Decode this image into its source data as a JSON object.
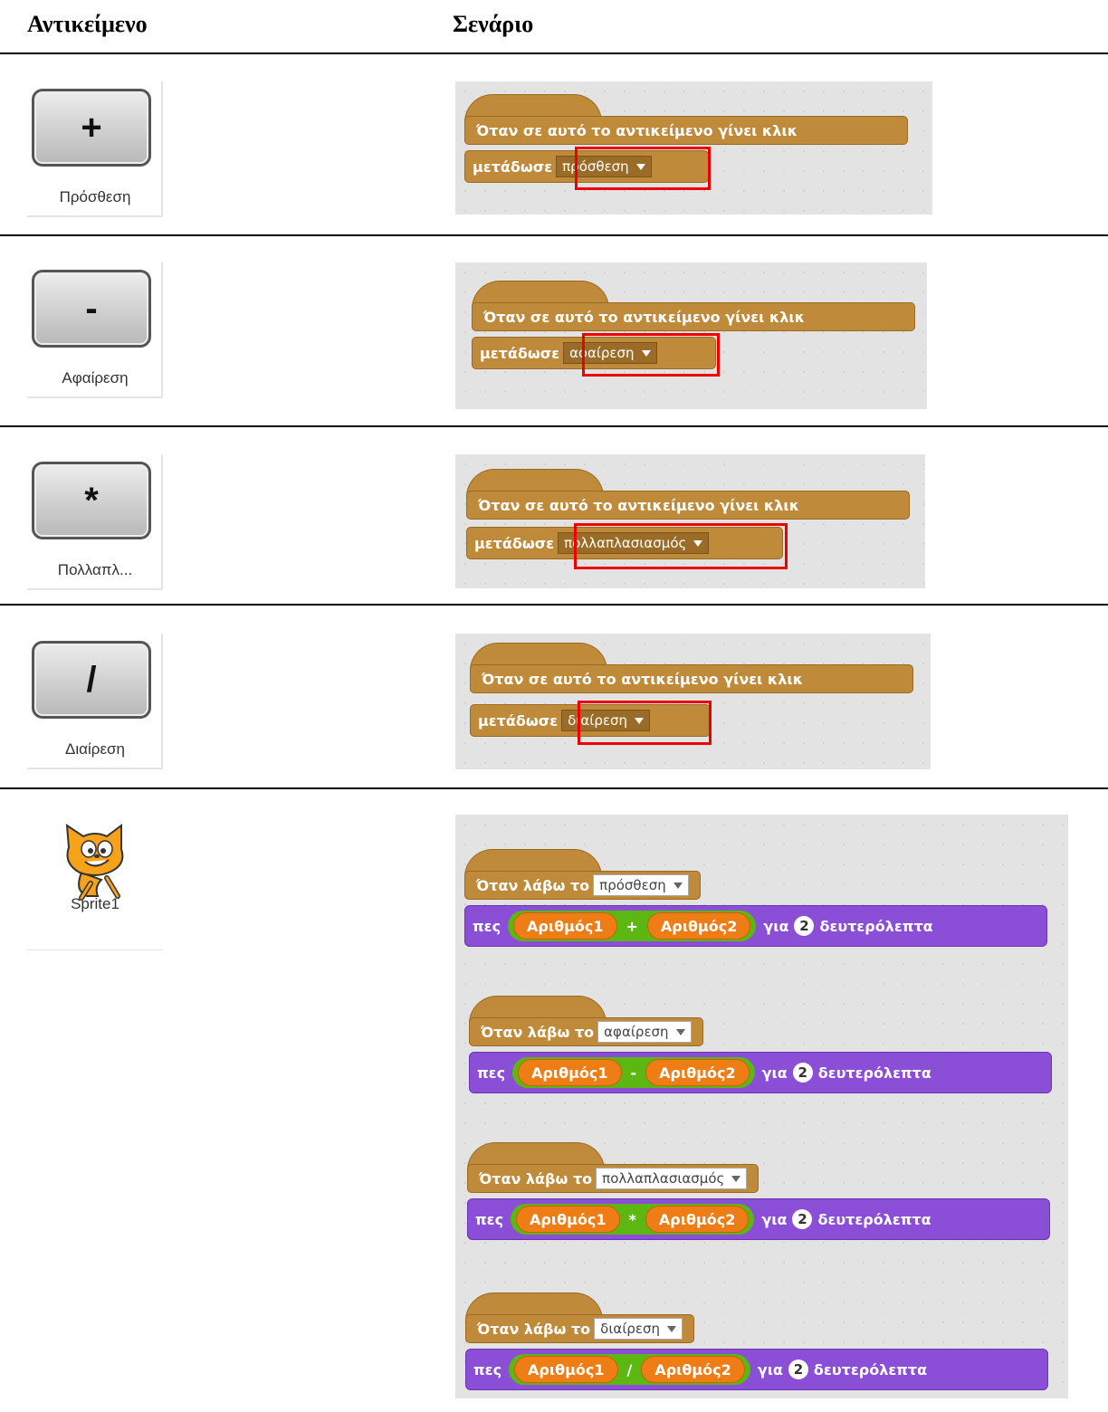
{
  "headers": {
    "object": "Αντικείμενο",
    "script": "Σενάριο"
  },
  "buttons": [
    {
      "symbol": "+",
      "name": "Πρόσθεση"
    },
    {
      "symbol": "-",
      "name": "Αφαίρεση"
    },
    {
      "symbol": "*",
      "name": "Πολλαπλ..."
    },
    {
      "symbol": "/",
      "name": "Διαίρεση"
    }
  ],
  "button_scripts": [
    {
      "hat": "Όταν σε αυτό το αντικείμενο γίνει κλικ",
      "cmd": "μετάδωσε",
      "message": "πρόσθεση"
    },
    {
      "hat": "Όταν σε αυτό το αντικείμενο γίνει κλικ",
      "cmd": "μετάδωσε",
      "message": "αφαίρεση"
    },
    {
      "hat": "Όταν σε αυτό το αντικείμενο γίνει κλικ",
      "cmd": "μετάδωσε",
      "message": "πολλαπλασιασμός"
    },
    {
      "hat": "Όταν σε αυτό το αντικείμενο γίνει κλικ",
      "cmd": "μετάδωσε",
      "message": "διαίρεση"
    }
  ],
  "sprite": {
    "name": "Sprite1"
  },
  "sprite_scripts": [
    {
      "hat": "Όταν λάβω το",
      "message": "πρόσθεση",
      "say": "πες",
      "var1": "Αριθμός1",
      "operator": "+",
      "var2": "Αριθμός2",
      "for": "για",
      "secs": "2",
      "unit": "δευτερόλεπτα"
    },
    {
      "hat": "Όταν λάβω το",
      "message": "αφαίρεση",
      "say": "πες",
      "var1": "Αριθμός1",
      "operator": "-",
      "var2": "Αριθμός2",
      "for": "για",
      "secs": "2",
      "unit": "δευτερόλεπτα"
    },
    {
      "hat": "Όταν λάβω το",
      "message": "πολλαπλασιασμός",
      "say": "πες",
      "var1": "Αριθμός1",
      "operator": "*",
      "var2": "Αριθμός2",
      "for": "για",
      "secs": "2",
      "unit": "δευτερόλεπτα"
    },
    {
      "hat": "Όταν λάβω το",
      "message": "διαίρεση",
      "say": "πες",
      "var1": "Αριθμός1",
      "operator": "/",
      "var2": "Αριθμός2",
      "for": "για",
      "secs": "2",
      "unit": "δευτερόλεπτα"
    }
  ],
  "colors": {
    "events": "#bf8a3a",
    "looks": "#8a4fd6",
    "operators": "#5cb712",
    "variables": "#ee7d16",
    "highlight": "#e00000"
  }
}
